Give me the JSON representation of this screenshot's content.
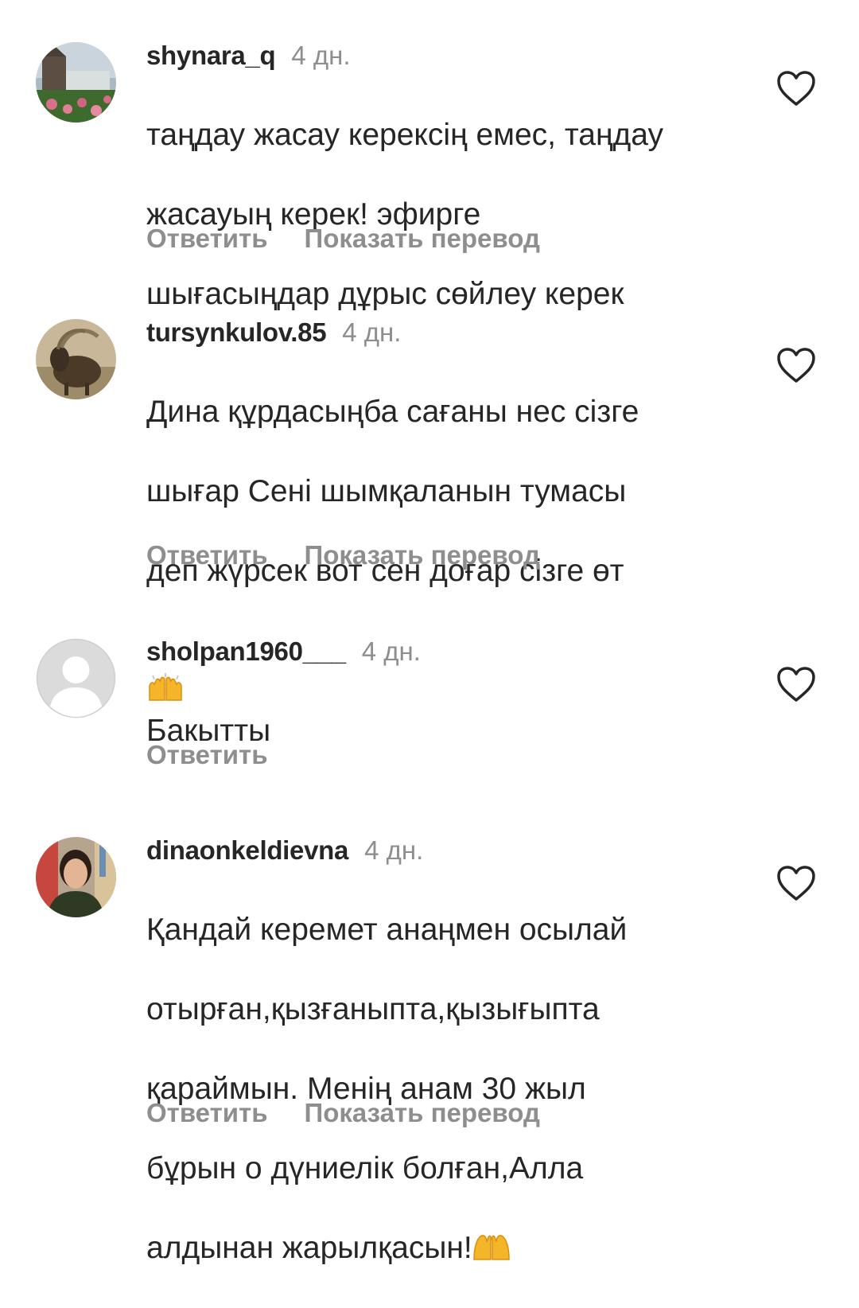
{
  "comments": [
    {
      "username": "shynara_q",
      "time": "4 дн.",
      "text_lines": [
        "таңдау жасау керексің емес, таңдау",
        "жасауың керек! эфирге",
        "шығасыңдар дұрыс сөйлеу керек"
      ],
      "emoji": false,
      "reply_label": "Ответить",
      "translate_label": "Показать перевод",
      "avatar_icon": "city-photo-avatar",
      "like_icon": "heart-outline-icon"
    },
    {
      "username": "tursynkulov.85",
      "time": "4 дн.",
      "text_lines": [
        "Дина құрдасыңба сағаны нес сізге",
        "шығар Сені шымқаланын тумасы",
        "деп жүрсек вот сен доғар сізге өт"
      ],
      "emoji": true,
      "reply_label": "Ответить",
      "translate_label": "Показать перевод",
      "avatar_icon": "ibex-photo-avatar",
      "like_icon": "heart-outline-icon"
    },
    {
      "username": "sholpan1960___",
      "time": "4 дн.",
      "text_lines": [
        "Бакытты"
      ],
      "emoji": false,
      "reply_label": "Ответить",
      "translate_label": "",
      "avatar_icon": "default-user-avatar",
      "like_icon": "heart-outline-icon"
    },
    {
      "username": "dinaonkeldievna",
      "time": "4 дн.",
      "text_lines": [
        "Қандай керемет анаңмен осылай",
        "отырған,қызғаныпта,қызығыпта",
        "қараймын. Менің анам 30 жыл",
        "бұрын о дүниелік болған,Алла",
        "алдынан жарылқасын!"
      ],
      "emoji": true,
      "reply_label": "Ответить",
      "translate_label": "Показать перевод",
      "avatar_icon": "woman-photo-avatar",
      "like_icon": "heart-outline-icon"
    }
  ],
  "colors": {
    "text": "#262626",
    "secondary": "#8e8e8e",
    "background": "#ffffff",
    "emoji": "#f5b529"
  }
}
